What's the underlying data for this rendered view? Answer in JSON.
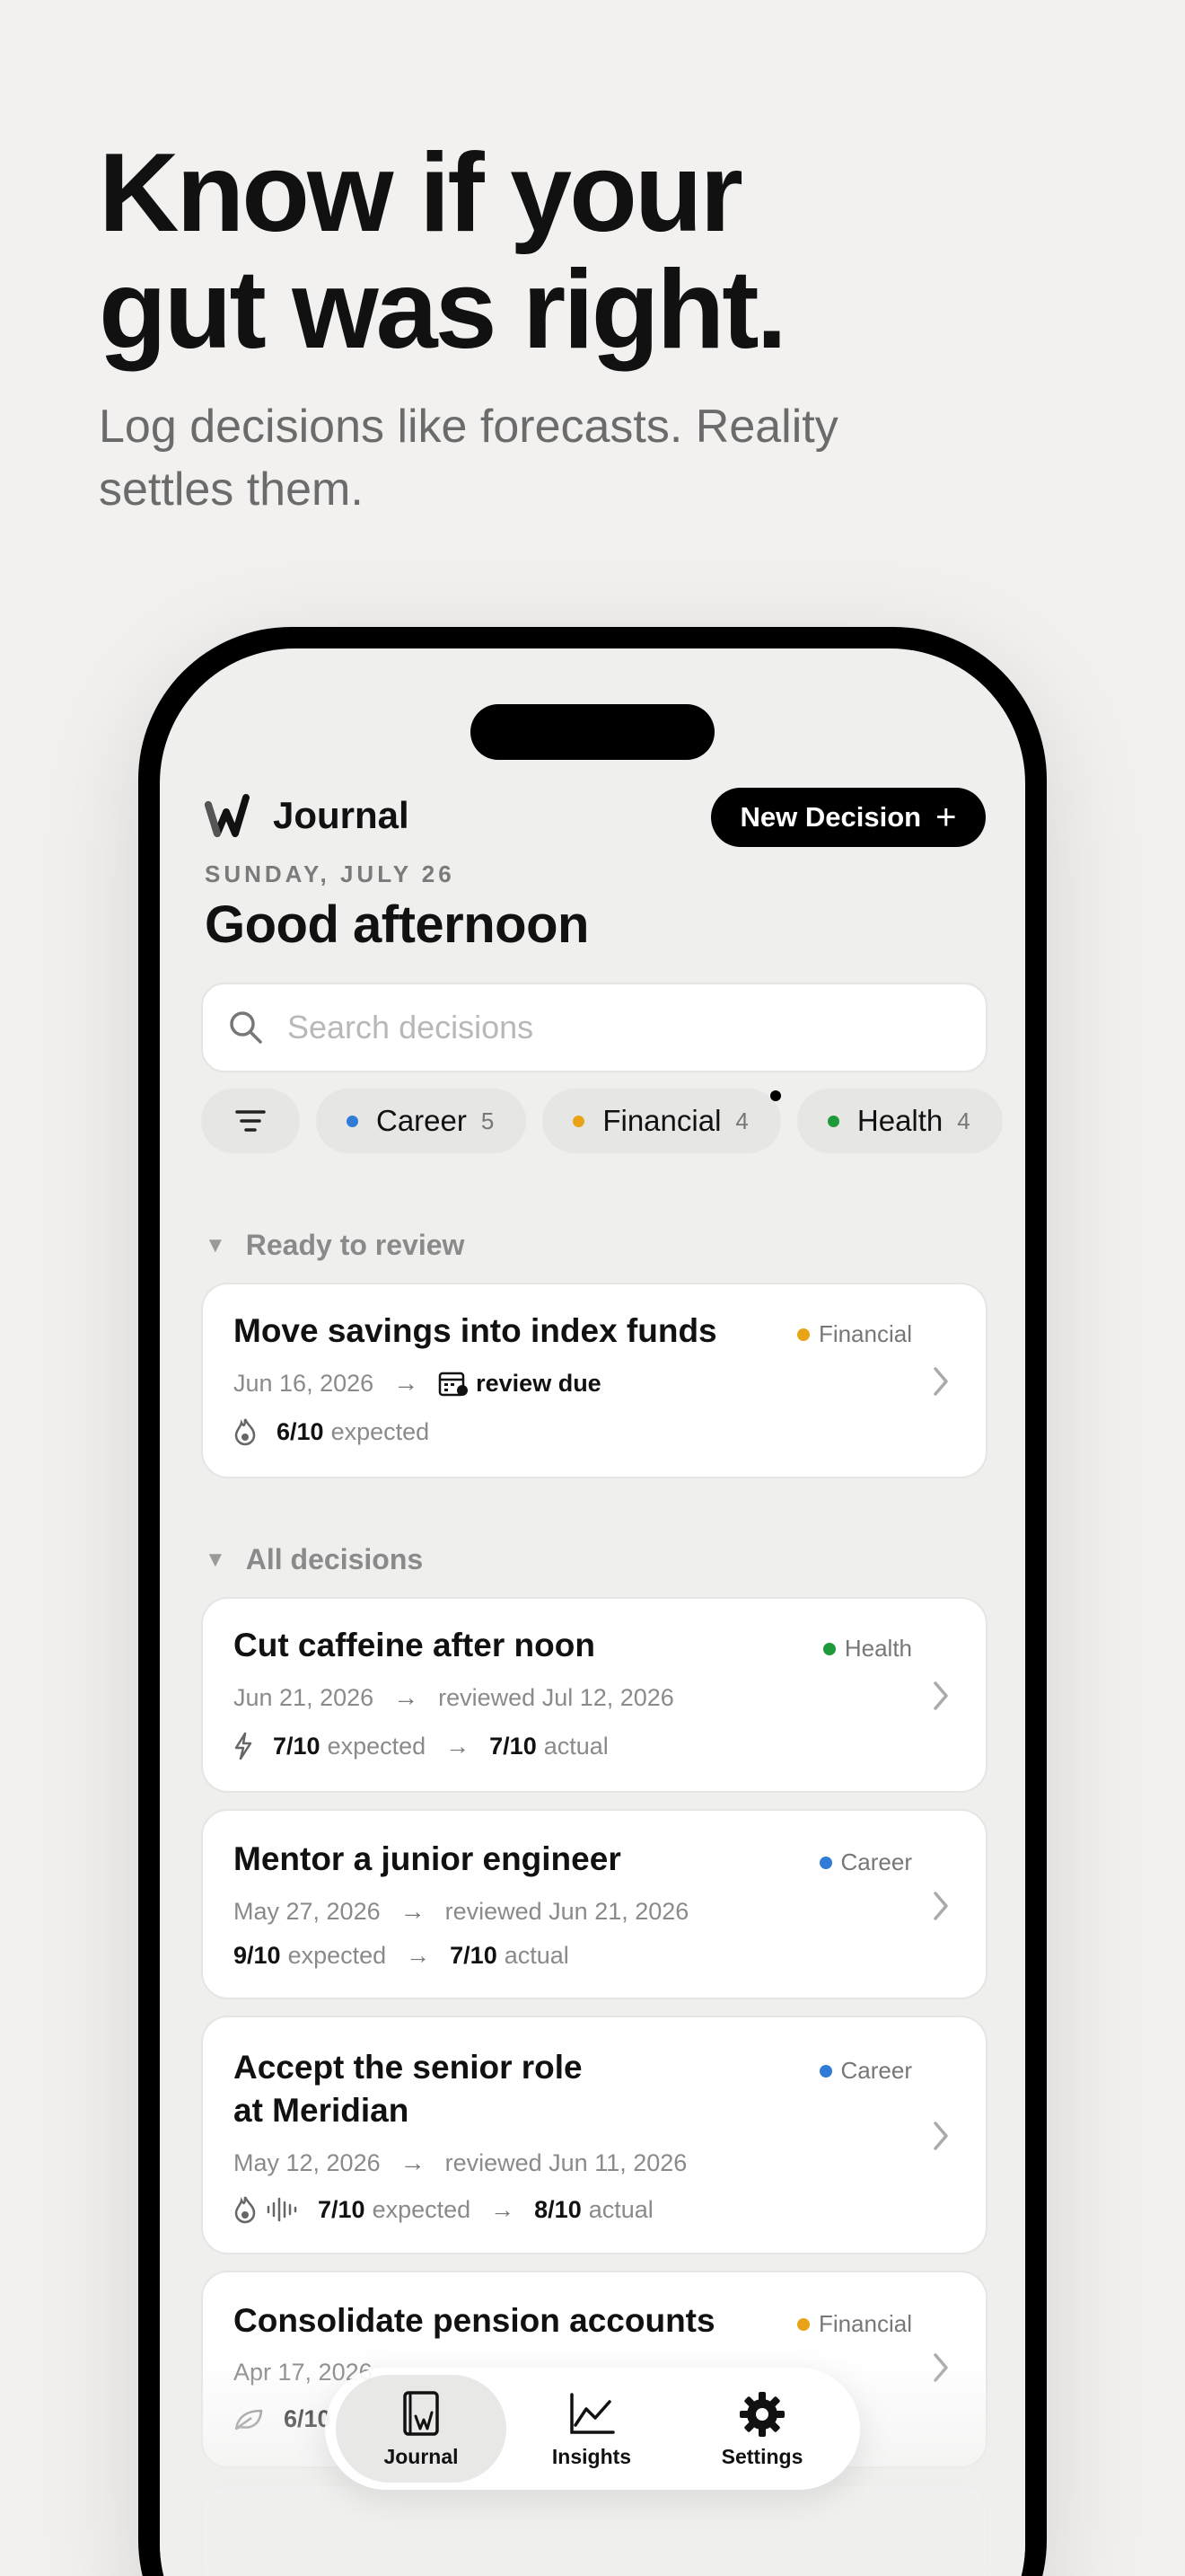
{
  "hero": {
    "title_line1": "Know if your",
    "title_line2": "gut was right.",
    "subtitle": "Log decisions like forecasts. Reality settles them."
  },
  "header": {
    "title": "Journal",
    "new_button": "New Decision",
    "new_button_icon": "+",
    "date": "SUNDAY, JULY 26",
    "greeting": "Good afternoon"
  },
  "search": {
    "placeholder": "Search decisions",
    "value": ""
  },
  "filters": {
    "icon": "filter-lines-icon",
    "chips": [
      {
        "label": "Career",
        "count": "5",
        "color": "#2f7bd6"
      },
      {
        "label": "Financial",
        "count": "4",
        "color": "#e8a317"
      },
      {
        "label": "Health",
        "count": "4",
        "color": "#1e9a3a"
      }
    ]
  },
  "sections": {
    "ready": "Ready to review",
    "all": "All decisions"
  },
  "ready_cards": [
    {
      "title": "Move savings into index funds",
      "tag": "Financial",
      "tag_color": "#e8a317",
      "date": "Jun 16, 2026",
      "status": "review due",
      "expected": "6/10",
      "expected_label": "expected"
    }
  ],
  "cards": [
    {
      "title": "Cut caffeine after noon",
      "tag": "Health",
      "tag_color": "#1e9a3a",
      "date": "Jun 21, 2026",
      "reviewed": "reviewed Jul 12, 2026",
      "expected": "7/10",
      "expected_label": "expected",
      "actual": "7/10",
      "actual_label": "actual"
    },
    {
      "title": "Mentor a junior engineer",
      "tag": "Career",
      "tag_color": "#2f7bd6",
      "date": "May 27, 2026",
      "reviewed": "reviewed Jun 21, 2026",
      "expected": "9/10",
      "expected_label": "expected",
      "actual": "7/10",
      "actual_label": "actual"
    },
    {
      "title_line1": "Accept the senior role",
      "title_line2": "at Meridian",
      "tag": "Career",
      "tag_color": "#2f7bd6",
      "date": "May 12, 2026",
      "reviewed": "reviewed Jun 11, 2026",
      "expected": "7/10",
      "expected_label": "expected",
      "actual": "8/10",
      "actual_label": "actual"
    },
    {
      "title": "Consolidate pension accounts",
      "tag": "Financial",
      "tag_color": "#e8a317",
      "date": "Apr 17, 2026",
      "expected": "6/10"
    }
  ],
  "tabbar": {
    "tabs": [
      {
        "label": "Journal",
        "icon": "journal-book-icon"
      },
      {
        "label": "Insights",
        "icon": "line-chart-icon"
      },
      {
        "label": "Settings",
        "icon": "gear-icon"
      }
    ]
  }
}
